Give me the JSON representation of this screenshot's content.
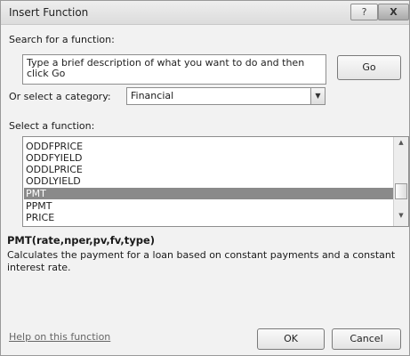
{
  "window": {
    "title": "Insert Function",
    "help_label": "?",
    "close_label": "X"
  },
  "search": {
    "label": "Search for a function:",
    "value": "Type a brief description of what you want to do and then click Go",
    "go_label": "Go"
  },
  "category": {
    "label": "Or select a category:",
    "selected": "Financial",
    "arrow": "▼"
  },
  "functions": {
    "label": "Select a function:",
    "items": [
      "ODDFPRICE",
      "ODDFYIELD",
      "ODDLPRICE",
      "ODDLYIELD",
      "PMT",
      "PPMT",
      "PRICE"
    ],
    "selected": "PMT",
    "scroll_up": "▲",
    "scroll_down": "▼"
  },
  "details": {
    "syntax": "PMT(rate,nper,pv,fv,type)",
    "description": "Calculates the payment for a loan based on constant payments and a constant interest rate."
  },
  "footer": {
    "help_link": "Help on this function",
    "ok_label": "OK",
    "cancel_label": "Cancel"
  },
  "colors": {
    "selection": "#8a8a8a",
    "dialog_bg": "#f2f2f2"
  }
}
